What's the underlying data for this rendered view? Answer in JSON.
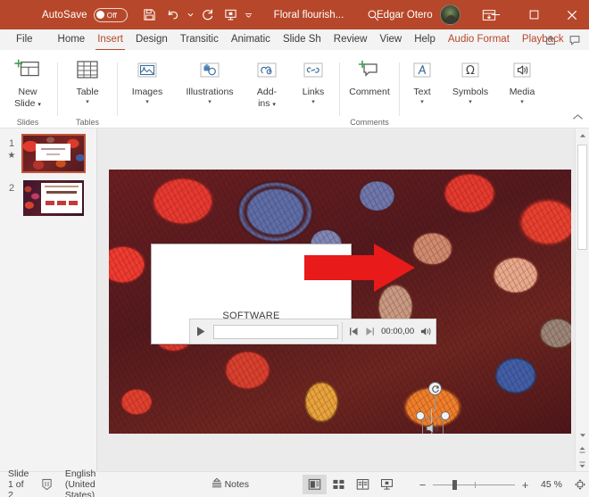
{
  "titlebar": {
    "autosave_label": "AutoSave",
    "autosave_state": "Off",
    "doc_title": "Floral flourish...",
    "user_name": "Edgar Otero",
    "quick_access": [
      {
        "name": "save-icon",
        "label": "Save"
      },
      {
        "name": "undo-icon",
        "label": "Undo"
      },
      {
        "name": "redo-icon",
        "label": "Redo"
      },
      {
        "name": "start-presentation-icon",
        "label": "Start From Beginning"
      },
      {
        "name": "customize-quick-access-icon",
        "label": "Customize Quick Access Toolbar"
      }
    ],
    "search_icon": "search-icon",
    "ribbon_display_icon": "ribbon-display-options-icon",
    "window_buttons": {
      "minimize": "–",
      "maximize": "☐",
      "close": "✕"
    }
  },
  "tabs": [
    {
      "label": "File",
      "active": false,
      "contextual": false
    },
    {
      "label": "Home",
      "active": false,
      "contextual": false
    },
    {
      "label": "Insert",
      "active": true,
      "contextual": false
    },
    {
      "label": "Design",
      "active": false,
      "contextual": false
    },
    {
      "label": "Transitic",
      "active": false,
      "contextual": false
    },
    {
      "label": "Animatiс",
      "active": false,
      "contextual": false
    },
    {
      "label": "Slide Sh",
      "active": false,
      "contextual": false
    },
    {
      "label": "Review",
      "active": false,
      "contextual": false
    },
    {
      "label": "View",
      "active": false,
      "contextual": false
    },
    {
      "label": "Help",
      "active": false,
      "contextual": false
    },
    {
      "label": "Audio Format",
      "active": false,
      "contextual": true
    },
    {
      "label": "Playback",
      "active": false,
      "contextual": true
    }
  ],
  "tabbar_right": [
    {
      "name": "share-icon",
      "label": "Share"
    },
    {
      "name": "comments-icon",
      "label": "Comments"
    }
  ],
  "ribbon": {
    "groups": [
      {
        "label": "Slides",
        "items": [
          {
            "name": "new-slide-button",
            "label": "New\nSlide",
            "label_line1": "New",
            "label_line2": "Slide",
            "caret": true,
            "icon": "new-slide-icon"
          }
        ]
      },
      {
        "label": "Tables",
        "items": [
          {
            "name": "table-button",
            "label_line1": "Table",
            "label_line2": "",
            "caret": true,
            "icon": "table-icon"
          }
        ]
      },
      {
        "label": "",
        "items": [
          {
            "name": "images-button",
            "label_line1": "Images",
            "label_line2": "",
            "caret": true,
            "icon": "images-icon"
          },
          {
            "name": "illustrations-button",
            "label_line1": "Illustrations",
            "label_line2": "",
            "caret": true,
            "icon": "illustrations-icon"
          },
          {
            "name": "add-ins-button",
            "label_line1": "Add-",
            "label_line2": "ins",
            "caret": true,
            "icon": "add-ins-icon"
          },
          {
            "name": "links-button",
            "label_line1": "Links",
            "label_line2": "",
            "caret": true,
            "icon": "links-icon"
          }
        ]
      },
      {
        "label": "Comments",
        "items": [
          {
            "name": "comment-button",
            "label_line1": "Comment",
            "label_line2": "",
            "caret": false,
            "icon": "comment-icon"
          }
        ]
      },
      {
        "label": "",
        "items": [
          {
            "name": "text-button",
            "label_line1": "Text",
            "label_line2": "",
            "caret": true,
            "icon": "text-icon"
          },
          {
            "name": "symbols-button",
            "label_line1": "Symbols",
            "label_line2": "",
            "caret": true,
            "icon": "symbols-icon"
          },
          {
            "name": "media-button",
            "label_line1": "Media",
            "label_line2": "",
            "caret": true,
            "icon": "media-icon"
          }
        ]
      }
    ],
    "collapse_icon": "collapse-ribbon-icon"
  },
  "thumbnails": [
    {
      "number": "1",
      "selected": true,
      "has_star": true
    },
    {
      "number": "2",
      "selected": false,
      "has_star": false
    }
  ],
  "slide": {
    "background_name": "floral-flourish-pattern",
    "content_box": {
      "text": "SOFTWARE"
    },
    "audio_object": {
      "name": "audio-speaker-object",
      "selected": true
    },
    "annotation": {
      "name": "red-arrow-annotation",
      "color": "#e81a1a"
    },
    "playbar": {
      "play_label": "Play",
      "time": "00:00,00",
      "back_label": "Move Back 0.25 Seconds",
      "forward_label": "Move Forward 0.25 Seconds",
      "volume_label": "Mute/Unmute"
    }
  },
  "statusbar": {
    "slide_count": "Slide 1 of 2",
    "accessibility_icon": "accessibility-checker-icon",
    "language": "English (United States)",
    "notes_label": "Notes",
    "views": [
      {
        "name": "view-normal",
        "label": "Normal",
        "active": true
      },
      {
        "name": "view-slide-sorter",
        "label": "Slide Sorter",
        "active": false
      },
      {
        "name": "view-reading",
        "label": "Reading View",
        "active": false
      },
      {
        "name": "view-slideshow",
        "label": "Slide Show",
        "active": false
      }
    ],
    "zoom_out": "−",
    "zoom_in": "+",
    "zoom_level": "45 %",
    "fit_icon": "fit-slide-to-window-icon"
  }
}
